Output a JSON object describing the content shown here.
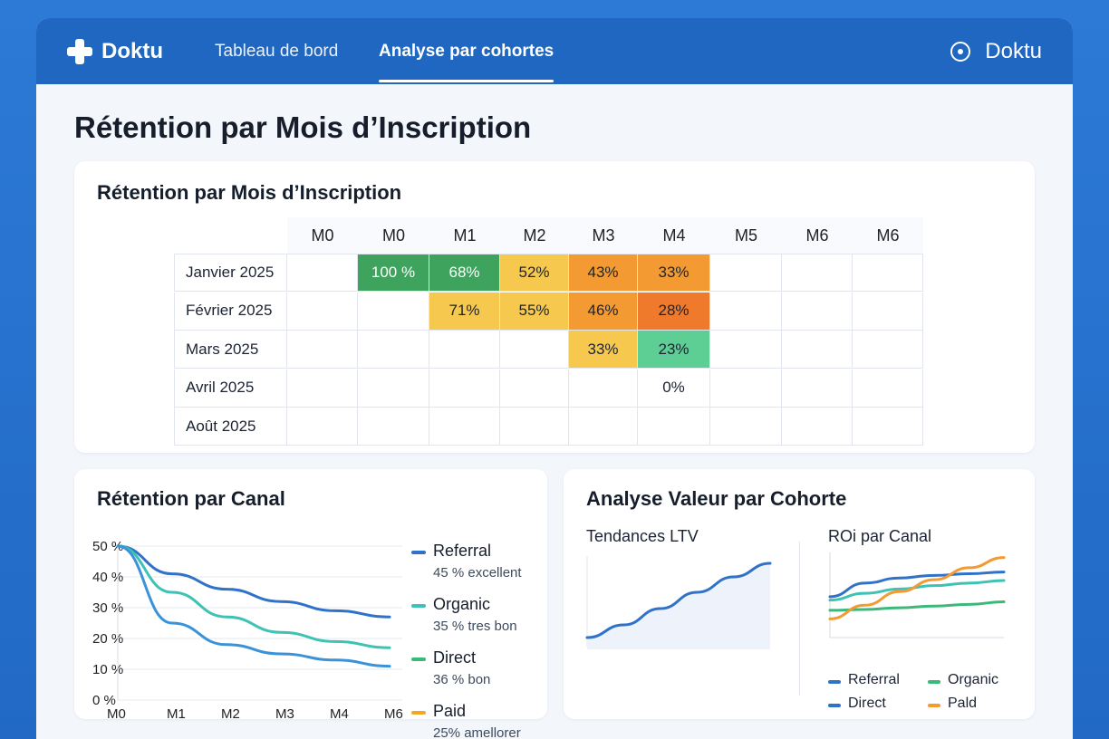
{
  "nav": {
    "brand": "Doktu",
    "tabs": [
      {
        "label": "Tableau de bord",
        "active": false
      },
      {
        "label": "Analyse par cohortes",
        "active": true
      }
    ],
    "user": "Doktu",
    "bg_color": "#1f67c1"
  },
  "page": {
    "title": "Rétention par Mois d’Inscription"
  },
  "heatmap_card": {
    "title": "Rétention par Mois d’Inscription",
    "columns": [
      "M0",
      "M0",
      "M1",
      "M2",
      "M3",
      "M4",
      "M5",
      "M6",
      "M6"
    ],
    "rows": [
      {
        "label": "Janvier 2025",
        "cells": [
          "",
          "100 %",
          "68%",
          "52%",
          "43%",
          "33%",
          "",
          "",
          ""
        ]
      },
      {
        "label": "Février 2025",
        "cells": [
          "",
          "",
          "71%",
          "55%",
          "46%",
          "28%",
          "",
          "",
          ""
        ]
      },
      {
        "label": "Mars 2025",
        "cells": [
          "",
          "",
          "",
          "",
          "33%",
          "23%",
          "",
          "",
          ""
        ]
      },
      {
        "label": "Avril 2025",
        "cells": [
          "",
          "",
          "",
          "",
          "",
          "0%",
          "",
          "",
          ""
        ]
      },
      {
        "label": "Août 2025",
        "cells": [
          "",
          "",
          "",
          "",
          "",
          "",
          "",
          "",
          ""
        ]
      }
    ],
    "colors": {
      "green_dark": "#3ea35d",
      "yellow": "#f6c94e",
      "orange": "#f39b32",
      "orange_dark": "#f07a2b",
      "green_light": "#5dcf94"
    }
  },
  "channel_card": {
    "title": "Rétention par Canal",
    "legend": [
      {
        "name": "Referral",
        "sub": "45 % excellent",
        "color": "#2f72c8"
      },
      {
        "name": "Organic",
        "sub": "35 % tres bon",
        "color": "#3fc2b4"
      },
      {
        "name": "Direct",
        "sub": "36 % bon",
        "color": "#3cb97a"
      },
      {
        "name": "Paid",
        "sub": "25% amellorer",
        "color": "#f3a623"
      }
    ]
  },
  "value_card": {
    "title": "Analyse Valeur par Cohorte",
    "ltv_title": "Tendances LTV",
    "roi_title": "ROi par Canal",
    "roi_legend": [
      {
        "name": "Referral",
        "color": "#2f72c8"
      },
      {
        "name": "Organic",
        "color": "#3cb97a"
      },
      {
        "name": "Direct",
        "color": "#2f72c8"
      },
      {
        "name": "Pald",
        "color": "#f39b32"
      }
    ]
  },
  "chart_data": [
    {
      "type": "line",
      "title": "Rétention par Canal",
      "x": [
        "M0",
        "M1",
        "M2",
        "M3",
        "M4",
        "M6"
      ],
      "ylim": [
        0,
        50
      ],
      "yticks": [
        "50 %",
        "40 %",
        "30 %",
        "20 %",
        "10 %",
        "0 %"
      ],
      "grid": true,
      "series": [
        {
          "name": "Referral",
          "values": [
            50,
            41,
            36,
            32,
            29,
            27
          ],
          "color": "#2f72c8"
        },
        {
          "name": "Organic",
          "values": [
            50,
            35,
            27,
            22,
            19,
            17
          ],
          "color": "#3fc2b4"
        },
        {
          "name": "Direct",
          "values": [
            50,
            25,
            18,
            15,
            13,
            11
          ],
          "color": "#3a92d8"
        }
      ]
    },
    {
      "type": "area",
      "title": "Tendances LTV",
      "x": [
        0,
        1,
        2,
        3,
        4,
        5
      ],
      "values": [
        10,
        24,
        42,
        60,
        77,
        92
      ],
      "ylim": [
        0,
        100
      ],
      "color": "#2f72c8"
    },
    {
      "type": "line",
      "title": "ROi par Canal",
      "x": [
        0,
        1,
        2,
        3,
        4,
        5
      ],
      "ylim": [
        0,
        100
      ],
      "series": [
        {
          "name": "Referral",
          "values": [
            48,
            64,
            70,
            73,
            75,
            77
          ],
          "color": "#2f72c8"
        },
        {
          "name": "Organic",
          "values": [
            44,
            52,
            57,
            61,
            64,
            67
          ],
          "color": "#3fc2b4"
        },
        {
          "name": "Direct",
          "values": [
            32,
            33,
            35,
            37,
            39,
            42
          ],
          "color": "#3cb97a"
        },
        {
          "name": "Pald",
          "values": [
            22,
            38,
            54,
            68,
            82,
            94
          ],
          "color": "#f39b32"
        }
      ]
    }
  ]
}
